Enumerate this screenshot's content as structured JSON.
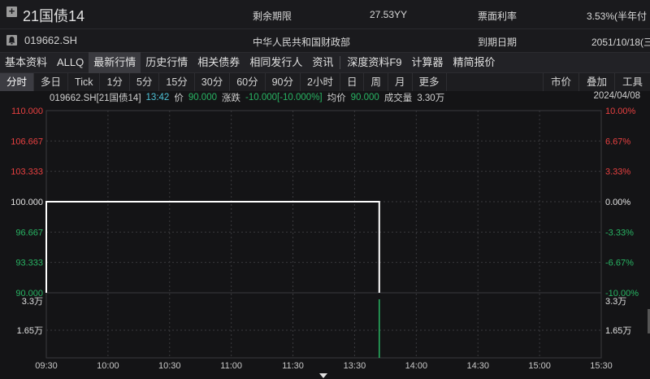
{
  "header": {
    "bond_name": "21国债14",
    "bond_code": "019662.SH",
    "remaining_label": "剩余期限",
    "remaining_value": "27.53YY",
    "coupon_label": "票面利率",
    "coupon_value": "3.53%(半年付",
    "issuer": "中华人民共和国财政部",
    "maturity_label": "到期日期",
    "maturity_value": "2051/10/18(三"
  },
  "tabs": [
    "基本资料",
    "ALLQ",
    "最新行情",
    "历史行情",
    "相关债券",
    "相同发行人",
    "资讯",
    "深度资料F9",
    "计算器",
    "精简报价"
  ],
  "active_tab": 2,
  "periods": [
    "分时",
    "多日",
    "Tick",
    "1分",
    "5分",
    "15分",
    "30分",
    "60分",
    "90分",
    "2小时",
    "日",
    "周",
    "月",
    "更多"
  ],
  "active_period": 0,
  "right_tools": [
    "市价",
    "叠加",
    "工具"
  ],
  "info": {
    "code_name": "019662.SH[21国债14]",
    "time": "13:42",
    "price_label": "价",
    "price": "90.000",
    "change_label": "涨跌",
    "change": "-10.000[-10.000%]",
    "avg_label": "均价",
    "avg": "90.000",
    "volume_label": "成交量",
    "volume": "3.30万",
    "date": "2024/04/08"
  },
  "colors": {
    "up": "#e84040",
    "down": "#28b463",
    "neutral": "#e0e0e0",
    "line": "#ffffff",
    "grid": "#3a3a3e"
  },
  "chart_data": {
    "type": "line",
    "x_ticks": [
      "09:30",
      "10:00",
      "10:30",
      "11:00",
      "11:30",
      "13:30",
      "14:00",
      "14:30",
      "15:00",
      "15:30"
    ],
    "price_ticks": [
      "110.000",
      "106.667",
      "103.333",
      "100.000",
      "96.667",
      "93.333",
      "90.000"
    ],
    "pct_ticks": [
      "10.00%",
      "6.67%",
      "3.33%",
      "0.00%",
      "-3.33%",
      "-6.67%",
      "-10.00%"
    ],
    "ylim": [
      90,
      110
    ],
    "reference_price": 100,
    "volume_ticks": [
      "3.3万",
      "1.65万"
    ],
    "volume_max": 3.3,
    "series": [
      {
        "values": [
          {
            "t": "09:30",
            "y": 90.0
          },
          {
            "t": "09:30",
            "y": 100.0
          },
          {
            "t": "13:42",
            "y": 100.0
          },
          {
            "t": "13:42",
            "y": 90.0
          }
        ]
      }
    ],
    "volume": [
      {
        "t": "13:42",
        "v": 3.3
      }
    ]
  }
}
